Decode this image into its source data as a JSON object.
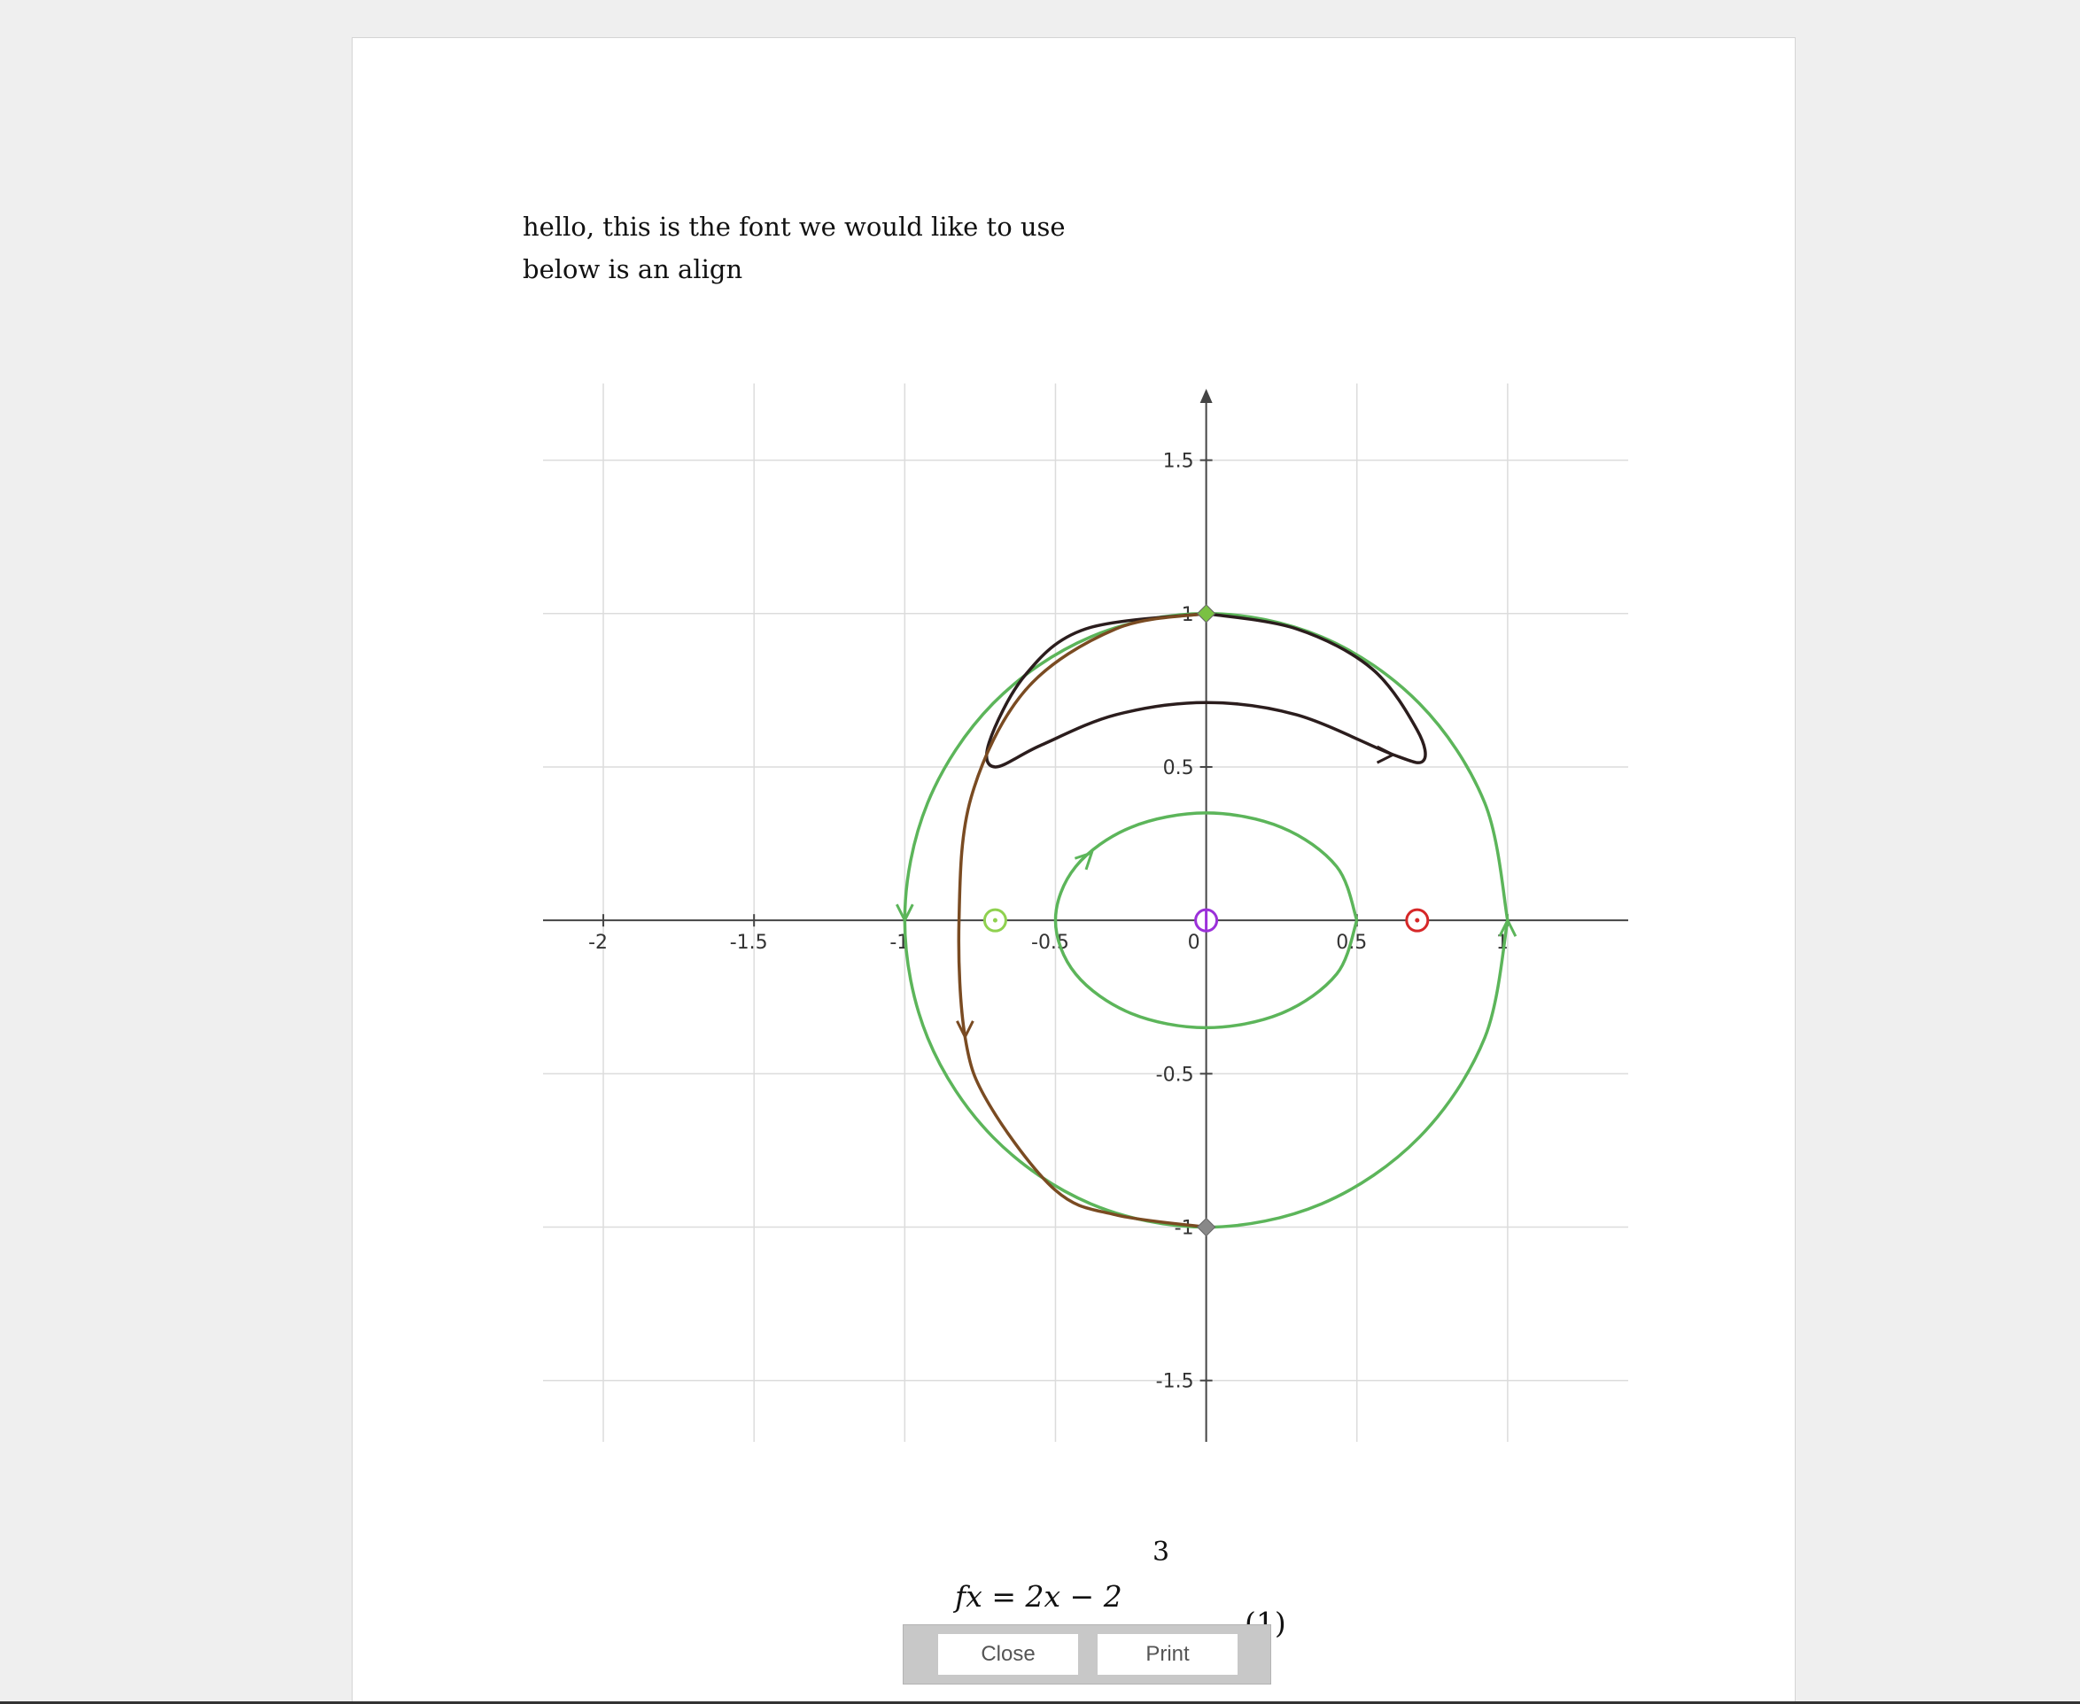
{
  "document": {
    "lines": [
      "hello, this is the font we would like to use",
      "below is an align"
    ],
    "equation": {
      "text": "fx = 2x − 2",
      "superscript": "3",
      "number": "(1)"
    }
  },
  "print_bar": {
    "close_label": "Close",
    "print_label": "Print"
  },
  "chart_data": {
    "type": "line",
    "title": "",
    "xlabel": "",
    "ylabel": "",
    "xlim": [
      -2.2,
      1.4
    ],
    "ylim": [
      -1.7,
      1.75
    ],
    "grid": true,
    "x_ticks": [
      "-2",
      "-1.5",
      "-1",
      "-0.5",
      "0",
      "0.5",
      "1"
    ],
    "x_tick_values": [
      -2,
      -1.5,
      -1,
      -0.5,
      0,
      0.5,
      1
    ],
    "y_ticks": [
      "1.5",
      "1",
      "0.5",
      "-0.5",
      "-1",
      "-1.5"
    ],
    "y_tick_values": [
      1.5,
      1,
      0.5,
      -0.5,
      -1,
      -1.5
    ],
    "series": [
      {
        "color": "#5cb55a",
        "curve": "circle",
        "points": [
          [
            1,
            0
          ],
          [
            0.924,
            0.383
          ],
          [
            0.707,
            0.707
          ],
          [
            0.383,
            0.924
          ],
          [
            0,
            1
          ],
          [
            -0.383,
            0.924
          ],
          [
            -0.707,
            0.707
          ],
          [
            -0.924,
            0.383
          ],
          [
            -1,
            0
          ],
          [
            -0.924,
            -0.383
          ],
          [
            -0.707,
            -0.707
          ],
          [
            -0.383,
            -0.924
          ],
          [
            0,
            -1
          ],
          [
            0.383,
            -0.924
          ],
          [
            0.707,
            -0.707
          ],
          [
            0.924,
            -0.383
          ],
          [
            1,
            0
          ]
        ],
        "arrows": [
          [
            -1,
            0,
            "down"
          ],
          [
            1,
            0,
            "up"
          ]
        ]
      },
      {
        "color": "#5cb55a",
        "curve": "ellipse",
        "points": [
          [
            0.5,
            0
          ],
          [
            0.433,
            0.175
          ],
          [
            0.25,
            0.303
          ],
          [
            0,
            0.35
          ],
          [
            -0.25,
            0.303
          ],
          [
            -0.433,
            0.175
          ],
          [
            -0.5,
            0
          ],
          [
            -0.433,
            -0.175
          ],
          [
            -0.25,
            -0.303
          ],
          [
            0,
            -0.35
          ],
          [
            0.25,
            -0.303
          ],
          [
            0.433,
            -0.175
          ],
          [
            0.5,
            0
          ]
        ],
        "arrows": [
          [
            -0.38,
            0.22,
            "up-right"
          ]
        ]
      },
      {
        "color": "#2b1d1d",
        "curve": "loop",
        "points": [
          [
            0,
            1
          ],
          [
            0.3,
            0.95
          ],
          [
            0.55,
            0.82
          ],
          [
            0.7,
            0.62
          ],
          [
            0.72,
            0.52
          ],
          [
            0.62,
            0.54
          ],
          [
            0.3,
            0.67
          ],
          [
            0,
            0.71
          ],
          [
            -0.3,
            0.67
          ],
          [
            -0.55,
            0.57
          ],
          [
            -0.7,
            0.5
          ],
          [
            -0.72,
            0.58
          ],
          [
            -0.6,
            0.8
          ],
          [
            -0.4,
            0.95
          ],
          [
            0,
            1
          ]
        ],
        "arrows": [
          [
            0.62,
            0.54,
            "right"
          ]
        ]
      },
      {
        "color": "#7a4b22",
        "curve": "swoop",
        "points": [
          [
            0,
            1
          ],
          [
            -0.3,
            0.95
          ],
          [
            -0.6,
            0.75
          ],
          [
            -0.78,
            0.4
          ],
          [
            -0.82,
            0
          ],
          [
            -0.8,
            -0.38
          ],
          [
            -0.72,
            -0.6
          ],
          [
            -0.5,
            -0.88
          ],
          [
            -0.3,
            -0.96
          ],
          [
            0,
            -1
          ]
        ],
        "arrows": [
          [
            -0.8,
            -0.38,
            "down"
          ]
        ]
      }
    ],
    "markers": [
      {
        "x": 0,
        "y": 1,
        "shape": "diamond",
        "color": "#7ac143"
      },
      {
        "x": 0,
        "y": -1,
        "shape": "diamond",
        "color": "#888888"
      },
      {
        "x": -0.7,
        "y": 0,
        "shape": "circle-dot",
        "color": "#8fd14f"
      },
      {
        "x": 0,
        "y": 0,
        "shape": "circle-cross",
        "color": "#9b30d9"
      },
      {
        "x": 0.7,
        "y": 0,
        "shape": "circle-dot",
        "color": "#d62728"
      }
    ]
  }
}
